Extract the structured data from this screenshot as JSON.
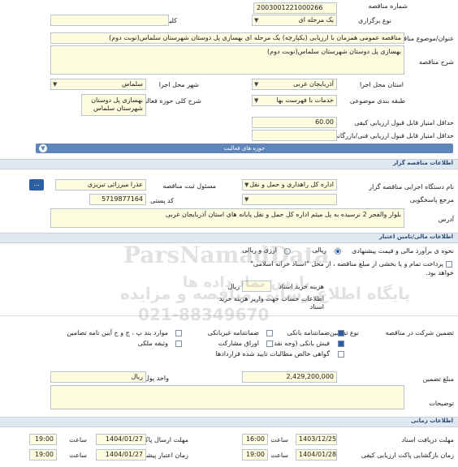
{
  "fields": {
    "tender_number": {
      "label": "شماره مناقصه",
      "value": "2003001221000266"
    },
    "holding_type": {
      "label": "نوع برگزاری",
      "value": "یک مرحله ای"
    },
    "keyword": {
      "label": "کلید واژه",
      "value": ""
    },
    "title": {
      "label": "عنوان/موضوع مناقصه",
      "value": "مناقصه عمومی همزمان با ارزیابی (یکپارچه) یک مرحله ای بهسازی پل دوستان شهرستان سلماس(نوبت دوم)"
    },
    "description": {
      "label": "شرح مناقصه",
      "value": "بهسازی پل دوستان شهرستان سلماس(نوبت دوم)"
    },
    "province": {
      "label": "استان محل اجرا",
      "value": "آذربایجان غربی"
    },
    "city": {
      "label": "شهر محل اجرا",
      "value": "سلماس"
    },
    "category": {
      "label": "طبقه بندی موضوعی",
      "value": "خدمات با فهرست بها"
    },
    "scope": {
      "label": "شرح کلی حوزه فعالیت",
      "value": "بهسازی پل دوستان شهرستان سلماس"
    },
    "min_quality_score": {
      "label": "حداقل امتیاز قابل قبول ارزیابی کیفی",
      "value": "60.00"
    },
    "min_tech_score": {
      "label": "حداقل امتیاز قابل قبول ارزیابی فنی/بازرگانی",
      "value": ""
    }
  },
  "collapse_bar": {
    "label": "حوزه های فعالیت"
  },
  "sections": {
    "organizer": "اطلاعات مناقصه گزار",
    "finance": "اطلاعات مالی/تامین اعتبار",
    "timing": "اطلاعات زمانی"
  },
  "organizer": {
    "agency": {
      "label": "نام دستگاه اجرایی مناقصه گزار",
      "value": "اداره کل راهداری و حمل و نقل"
    },
    "registrar": {
      "label": "مسئول ثبت مناقصه",
      "value": "عذرا میرزائی تبریزی"
    },
    "reply_ref": {
      "label": "مرجع پاسخگویی",
      "value": ""
    },
    "postal_code": {
      "label": "کد پستی",
      "value": "5719877164"
    },
    "address": {
      "label": "آدرس",
      "value": "بلوار والفجر 2 نرسیده به پل میثم اداره کل حمل و نقل پایانه های استان آذربایجان غربی"
    },
    "dots_label": "..."
  },
  "finance": {
    "estimate_label": "نحوه ی برآورد مالی و قیمت پیشنهادی",
    "estimate_options": [
      "ریالی",
      "ارزی و ریالی"
    ],
    "payment_text_1": "پرداخت تمام و یا بخشی از مبلغ مناقصه ، از محل \"اسناد خزانه اسلامی\"",
    "payment_text_2": "خواهد بود.",
    "doc_price_label": "هزینه خرید اسناد",
    "doc_price_unit": "ریال",
    "account_label_1": "اطلاعات حساب جهت واریز هزینه خرید",
    "account_label_2": "اسناد",
    "account_value": "...",
    "guarantee_label": "تضمین شرکت در مناقصه",
    "guarantee_type_label": "نوع تضمین",
    "guarantee_options": [
      {
        "label": "ضمانتنامه بانکی",
        "checked": true
      },
      {
        "label": "ضمانتنامه غیربانکی",
        "checked": false
      },
      {
        "label": "موارد بند پ ، ج و خ آیین نامه تضامین",
        "checked": false
      },
      {
        "label": "فیش بانکی (وجه نقد)",
        "checked": true
      },
      {
        "label": "اوراق مشارکت",
        "checked": false
      },
      {
        "label": "وثیقه ملکی",
        "checked": false
      },
      {
        "label": "گواهی خالص مطالبات تایید شده قراردادها",
        "checked": false
      }
    ],
    "amount_label": "مبلغ تضمین",
    "amount_value": "2,429,200,000",
    "currency_label": "واحد پول",
    "currency_value": "ریال",
    "notes_label": "توضیحات"
  },
  "timing": {
    "doc_receive_label": "مهلت دریافت اسناد",
    "doc_receive_date": "1403/12/25",
    "doc_receive_time": "16:00",
    "send_deadline_label": "مهلت ارسال پاکتهای پیشنهاد",
    "send_deadline_date": "1404/01/27",
    "send_deadline_time": "19:00",
    "quality_open_label": "زمان بازگشایی پاکت ارزیابی کیفی",
    "quality_open_date": "1404/01/28",
    "quality_open_time": "19:00",
    "validity_label": "زمان اعتبار پیشنهاد",
    "validity_date": "1404/01/27",
    "validity_time": "19:00",
    "time_label": "ساعت"
  },
  "watermark": {
    "logo": "ParsNamadData",
    "tagline": "پارس نماد داده ها",
    "footer": "پایگاه اطلاع رسانی مناقصه و مزایده",
    "phone": "021-88349670"
  },
  "colors": {
    "input_bg": "#fffde0",
    "section_bg": "#dfe7f1",
    "accent": "#2e5fa3"
  }
}
